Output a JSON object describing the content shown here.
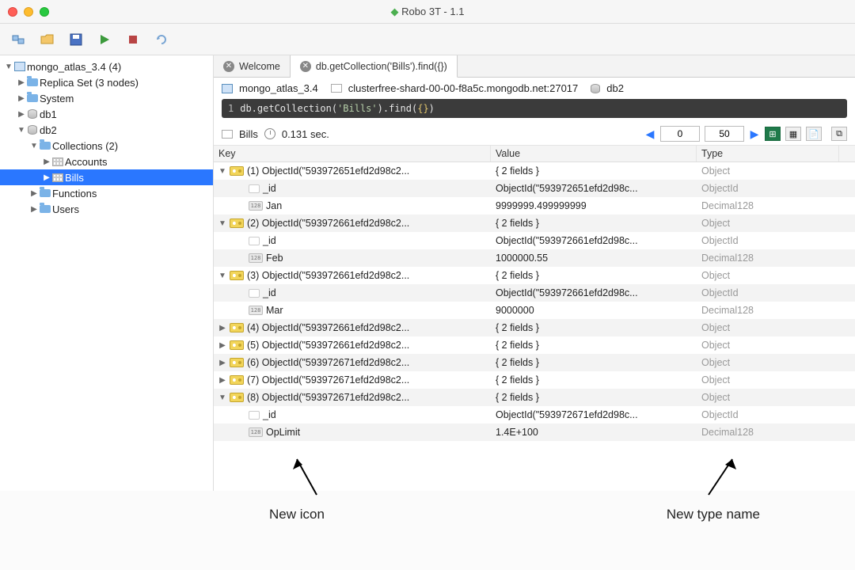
{
  "title": "Robo 3T - 1.1",
  "tabs": {
    "welcome": "Welcome",
    "query": "db.getCollection('Bills').find({})"
  },
  "conn": {
    "server": "mongo_atlas_3.4",
    "host": "clusterfree-shard-00-00-f8a5c.mongodb.net:27017",
    "db": "db2"
  },
  "query_display": {
    "ln": "1",
    "cmd_pre": "db.getCollection(",
    "arg": "'Bills'",
    "cmd_mid": ").find(",
    "arg2": "{}",
    "cmd_post": ")"
  },
  "result_bar": {
    "coll": "Bills",
    "time": "0.131 sec.",
    "skip": "0",
    "limit": "50"
  },
  "columns": {
    "key": "Key",
    "value": "Value",
    "type": "Type"
  },
  "tree": {
    "root": "mongo_atlas_3.4 (4)",
    "replica": "Replica Set (3 nodes)",
    "system": "System",
    "db1": "db1",
    "db2": "db2",
    "collections": "Collections (2)",
    "accounts": "Accounts",
    "bills": "Bills",
    "functions": "Functions",
    "users": "Users"
  },
  "rows": [
    {
      "expanded": "▼",
      "indent": 0,
      "icon": "doc",
      "key": "(1) ObjectId(\"593972651efd2d98c2...",
      "value": "{ 2 fields }",
      "type": "Object"
    },
    {
      "expanded": "",
      "indent": 1,
      "icon": "empty",
      "key": "_id",
      "value": "ObjectId(\"593972651efd2d98c...",
      "type": "ObjectId"
    },
    {
      "expanded": "",
      "indent": 1,
      "icon": "num",
      "key": "Jan",
      "value": "9999999.499999999",
      "type": "Decimal128"
    },
    {
      "expanded": "▼",
      "indent": 0,
      "icon": "doc",
      "key": "(2) ObjectId(\"593972661efd2d98c2...",
      "value": "{ 2 fields }",
      "type": "Object"
    },
    {
      "expanded": "",
      "indent": 1,
      "icon": "empty",
      "key": "_id",
      "value": "ObjectId(\"593972661efd2d98c...",
      "type": "ObjectId"
    },
    {
      "expanded": "",
      "indent": 1,
      "icon": "num",
      "key": "Feb",
      "value": "1000000.55",
      "type": "Decimal128"
    },
    {
      "expanded": "▼",
      "indent": 0,
      "icon": "doc",
      "key": "(3) ObjectId(\"593972661efd2d98c2...",
      "value": "{ 2 fields }",
      "type": "Object"
    },
    {
      "expanded": "",
      "indent": 1,
      "icon": "empty",
      "key": "_id",
      "value": "ObjectId(\"593972661efd2d98c...",
      "type": "ObjectId"
    },
    {
      "expanded": "",
      "indent": 1,
      "icon": "num",
      "key": "Mar",
      "value": "9000000",
      "type": "Decimal128"
    },
    {
      "expanded": "▶",
      "indent": 0,
      "icon": "doc",
      "key": "(4) ObjectId(\"593972661efd2d98c2...",
      "value": "{ 2 fields }",
      "type": "Object"
    },
    {
      "expanded": "▶",
      "indent": 0,
      "icon": "doc",
      "key": "(5) ObjectId(\"593972661efd2d98c2...",
      "value": "{ 2 fields }",
      "type": "Object"
    },
    {
      "expanded": "▶",
      "indent": 0,
      "icon": "doc",
      "key": "(6) ObjectId(\"593972671efd2d98c2...",
      "value": "{ 2 fields }",
      "type": "Object"
    },
    {
      "expanded": "▶",
      "indent": 0,
      "icon": "doc",
      "key": "(7) ObjectId(\"593972671efd2d98c2...",
      "value": "{ 2 fields }",
      "type": "Object"
    },
    {
      "expanded": "▼",
      "indent": 0,
      "icon": "doc",
      "key": "(8) ObjectId(\"593972671efd2d98c2...",
      "value": "{ 2 fields }",
      "type": "Object"
    },
    {
      "expanded": "",
      "indent": 1,
      "icon": "empty",
      "key": "_id",
      "value": "ObjectId(\"593972671efd2d98c...",
      "type": "ObjectId"
    },
    {
      "expanded": "",
      "indent": 1,
      "icon": "num",
      "key": "OpLimit",
      "value": "1.4E+100",
      "type": "Decimal128"
    }
  ],
  "annot": {
    "left": "New icon",
    "right": "New type name"
  }
}
